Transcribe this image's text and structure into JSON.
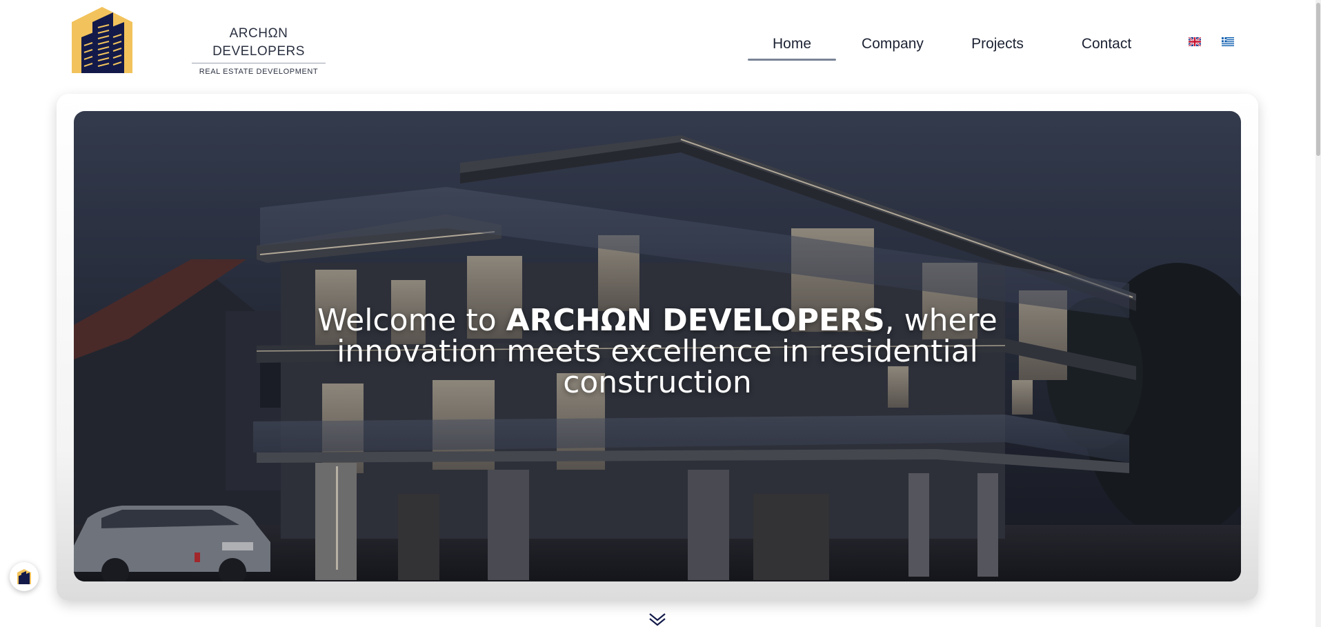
{
  "brand": {
    "name": "ARCHΩN DEVELOPERS",
    "tagline": "REAL ESTATE DEVELOPMENT"
  },
  "nav": {
    "items": [
      {
        "label": "Home",
        "active": true
      },
      {
        "label": "Company",
        "active": false
      },
      {
        "label": "Projects",
        "active": false
      },
      {
        "label": "Contact",
        "active": false
      }
    ]
  },
  "languages": [
    {
      "icon": "uk-flag-icon",
      "code": "en"
    },
    {
      "icon": "greece-flag-icon",
      "code": "el"
    }
  ],
  "hero": {
    "line1_prefix": "Welcome to ",
    "line1_brand": "ARCHΩN DEVELOPERS",
    "line1_suffix": ", where",
    "line2": "innovation meets excellence in residential",
    "line3": "construction"
  },
  "icons": {
    "scroll": "chevron-double-down-icon",
    "fab": "building-logo-icon"
  },
  "colors": {
    "accent_gold": "#f2c35c",
    "brand_navy": "#131a4a",
    "nav_underline": "#7a8496"
  }
}
